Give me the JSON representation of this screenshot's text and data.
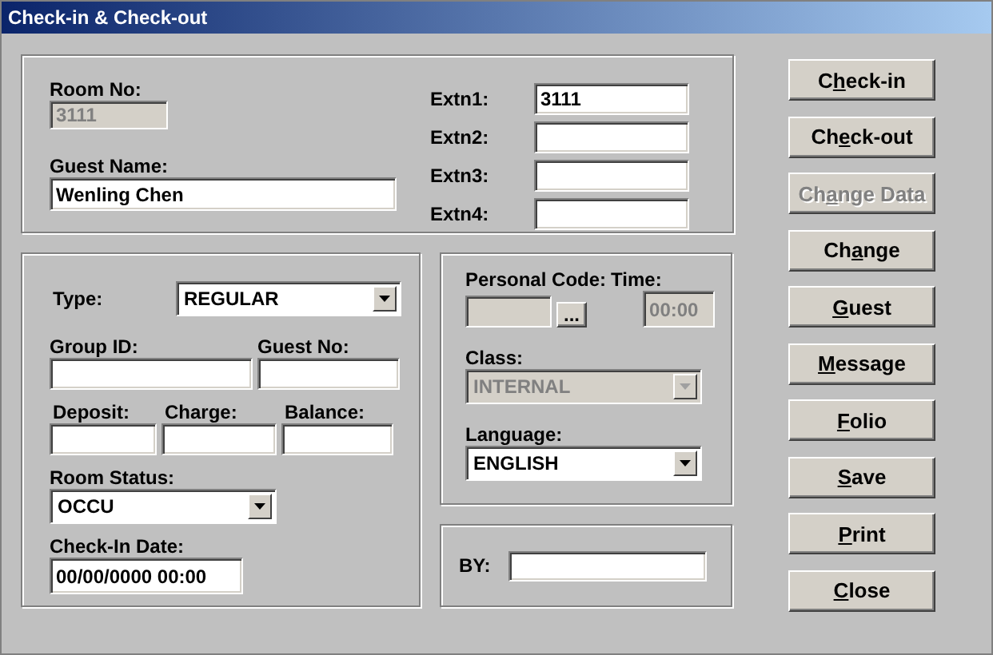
{
  "window": {
    "title": "Check-in & Check-out"
  },
  "room": {
    "room_no": {
      "label": "Room No:",
      "value": "3111",
      "disabled": true
    },
    "guest_name": {
      "label": "Guest Name:",
      "value": "Wenling Chen",
      "disabled": false
    },
    "extensions": [
      {
        "label": "Extn1:",
        "value": "3111"
      },
      {
        "label": "Extn2:"
      },
      {
        "label": "Extn3:"
      },
      {
        "label": "Extn4:"
      }
    ]
  },
  "details": {
    "type": {
      "label": "Type:",
      "value": "REGULAR",
      "disabled": false
    },
    "group_id": {
      "label": "Group ID:"
    },
    "guest_no": {
      "label": "Guest No:"
    },
    "deposit": {
      "label": "Deposit:"
    },
    "charge": {
      "label": "Charge:"
    },
    "balance": {
      "label": "Balance:"
    },
    "room_status": {
      "label": "Room Status:",
      "value": "OCCU",
      "disabled": false
    },
    "check_in_date": {
      "label": "Check-In Date:",
      "value": "00/00/0000 00:00"
    }
  },
  "personal": {
    "personal_code": {
      "label": "Personal Code:",
      "disabled": true
    },
    "browse": {
      "label": "..."
    },
    "time": {
      "label": "Time:",
      "value": "00:00",
      "disabled": true
    },
    "class": {
      "label": "Class:",
      "value": "INTERNAL",
      "disabled": true
    },
    "language": {
      "label": "Language:",
      "value": "ENGLISH",
      "disabled": false
    }
  },
  "by": {
    "label": "BY:"
  },
  "buttons": [
    {
      "label_parts": [
        {
          "text": "C",
          "underline": false
        },
        {
          "text": "h",
          "underline": true
        },
        {
          "text": "eck-in",
          "underline": false
        }
      ],
      "disabled": false
    },
    {
      "label_parts": [
        {
          "text": "Ch",
          "underline": false
        },
        {
          "text": "e",
          "underline": true
        },
        {
          "text": "ck-out",
          "underline": false
        }
      ],
      "disabled": false
    },
    {
      "label_parts": [
        {
          "text": "Ch",
          "underline": false
        },
        {
          "text": "a",
          "underline": true
        },
        {
          "text": "nge Data",
          "underline": false
        }
      ],
      "disabled": true
    },
    {
      "label_parts": [
        {
          "text": "Ch",
          "underline": false
        },
        {
          "text": "a",
          "underline": true
        },
        {
          "text": "nge",
          "underline": false
        }
      ],
      "disabled": false
    },
    {
      "label_parts": [
        {
          "text": "G",
          "underline": true
        },
        {
          "text": "uest",
          "underline": false
        }
      ],
      "disabled": false
    },
    {
      "label_parts": [
        {
          "text": "M",
          "underline": true
        },
        {
          "text": "essage",
          "underline": false
        }
      ],
      "disabled": false
    },
    {
      "label_parts": [
        {
          "text": "F",
          "underline": true
        },
        {
          "text": "olio",
          "underline": false
        }
      ],
      "disabled": false
    },
    {
      "label_parts": [
        {
          "text": "S",
          "underline": true
        },
        {
          "text": "ave",
          "underline": false
        }
      ],
      "disabled": false
    },
    {
      "label_parts": [
        {
          "text": "P",
          "underline": true
        },
        {
          "text": "rint",
          "underline": false
        }
      ],
      "disabled": false
    },
    {
      "label_parts": [
        {
          "text": "C",
          "underline": true
        },
        {
          "text": "lose",
          "underline": false
        }
      ],
      "disabled": false
    }
  ]
}
